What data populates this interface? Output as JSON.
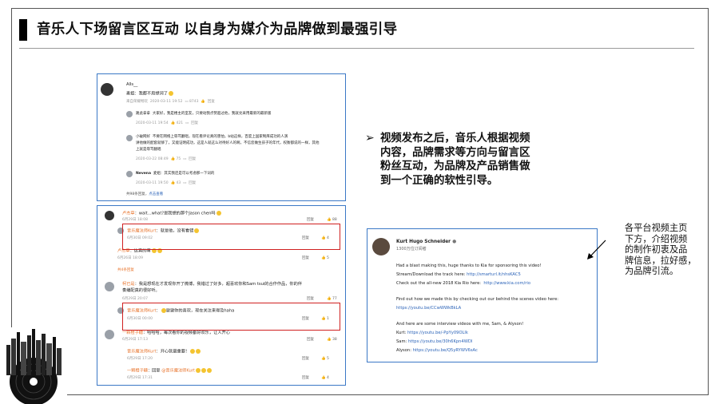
{
  "title": "音乐人下场留言区互动 以自身为媒介为品牌做到最强引导",
  "bullet": {
    "marker": "➢",
    "lines": [
      "视频发布之后，音乐人根据视频",
      "内容，品牌需求等方向与留言区",
      "粉丝互动，为品牌及产品销售做",
      "到一个正确的软性引导。"
    ]
  },
  "side_note": {
    "lines": [
      "各平台视频主页",
      "下方，介绍视频",
      "的制作初衷及品",
      "牌信息，拉好感，",
      "为品牌引流。"
    ]
  },
  "panel1": {
    "c1": {
      "name": "Alls__",
      "text": "麦姐：我都不用想词了",
      "meta": "来自荣耀畅玩",
      "time": "2020-03-11 19:52",
      "likes": "8743",
      "reply": "回复"
    },
    "c2": {
      "name": "路此拿拿",
      "text": "大家好，我是楼主的室友，只要动我点赞超过他，我就兑采用最新的最新版",
      "time": "2020-03-11 19:54",
      "likes": "421",
      "reply": "回复"
    },
    "c3": {
      "name": "小破网好",
      "line1": "不要在网络上辱骂翻唱，现在看评论真的害怕，b站这样，百度上国家制库成功的人演",
      "line2": "讲他做的配套就够了，又能证明成功，这是人就这么对待好人的啊，不信您做生孩子的年代，权衡都说的一样，其他",
      "line3": "上就是辱骂翻唱",
      "time": "2020-03-22 08:49",
      "likes": "75",
      "reply": "回复"
    },
    "c4": {
      "name": "Nevena",
      "text": "麦姐：其实我还是可以考虑那一下词的",
      "time": "2020-03-11 19:50",
      "likes": "43",
      "reply": "回复"
    },
    "footer": "共98条回复，",
    "more": "点击查看"
  },
  "panel2": {
    "r1": {
      "name": "卢杰草",
      "text": "wait...what?是我想的那个Jason chen吗",
      "date": "6月29日 18:08",
      "reply": "回复",
      "likes": "88"
    },
    "r2": {
      "name": "音乐魔法师Kurt",
      "text": "就是他，没有看错",
      "date": "6月30日 09:02",
      "reply": "回复",
      "likes": "4"
    },
    "r3": {
      "name": "卢杰草",
      "text": "这真的嘛",
      "date": "6月26日 18:09",
      "reply": "回复",
      "likes": "5"
    },
    "r3_more": "共4条回复",
    "r4": {
      "name": "柯已是",
      "line1": "我是想现在才发现你开了微博，我错过了好多，超喜欢你和Sam tsui的合作作品，你的伴",
      "line2": "奏编配真的很好听。",
      "date": "6月29日 20:07",
      "reply": "回复",
      "likes": "77"
    },
    "r5": {
      "name": "音乐魔法师Kurt",
      "text": "谢谢你的喜欢，现在关注来得及haha",
      "date": "6月30日 00:00",
      "reply": "回复",
      "likes": "1"
    },
    "r6": {
      "name": "一颗橙子糖",
      "text": "哈哈哈，每次看你的视频都好欢乐，让人开心",
      "date": "6月29日 17:13",
      "reply": "回复",
      "likes": "38"
    },
    "r7": {
      "name": "音乐魔法师Kurt",
      "text": "开心就最重要！",
      "date": "6月29日 17:20",
      "reply": "回复",
      "likes": "5"
    },
    "r8": {
      "name": "一颗橙子糖",
      "text": "回复",
      "mention": "@音乐魔法师Kurt",
      "date": "6月29日 17:31",
      "reply": "回复",
      "likes": "4"
    }
  },
  "panel3": {
    "channel": "Kurt Hugo Schneider",
    "subs": "1300万位订阅者",
    "p1": [
      "Had a blast making this, huge thanks to Kia for sponsoring this video!"
    ],
    "stream_label": "Stream/Download the track here: ",
    "stream_url": "http://smarturl.it/nhsKAC5",
    "kia_label": "Check out the all-new 2018 Kia Rio here: ",
    "kia_url": "http://www.kia.com/rio",
    "bts_line": "Find out how we made this by checking out our behind the scenes video here:",
    "bts_url": "https://youtu.be/CCwWWkBkLA",
    "interview_line": "And here are some interview videos with me, Sam, & Alyson!",
    "kurt_label": "Kurt: ",
    "kurt_url": "https://youtu.be/-PpYy09OLlk",
    "sam_label": "Sam: ",
    "sam_url": "https://youtu.be/30h6Kpn4WDI",
    "alyson_label": "Alyson: ",
    "alyson_url": "https://youtu.be/Q5yRYWV6sAc"
  },
  "colors": {
    "accent_blue": "#3b78c6",
    "highlight_red": "#d02020",
    "link_blue": "#2b63b8",
    "orange_name": "#e8742c"
  }
}
